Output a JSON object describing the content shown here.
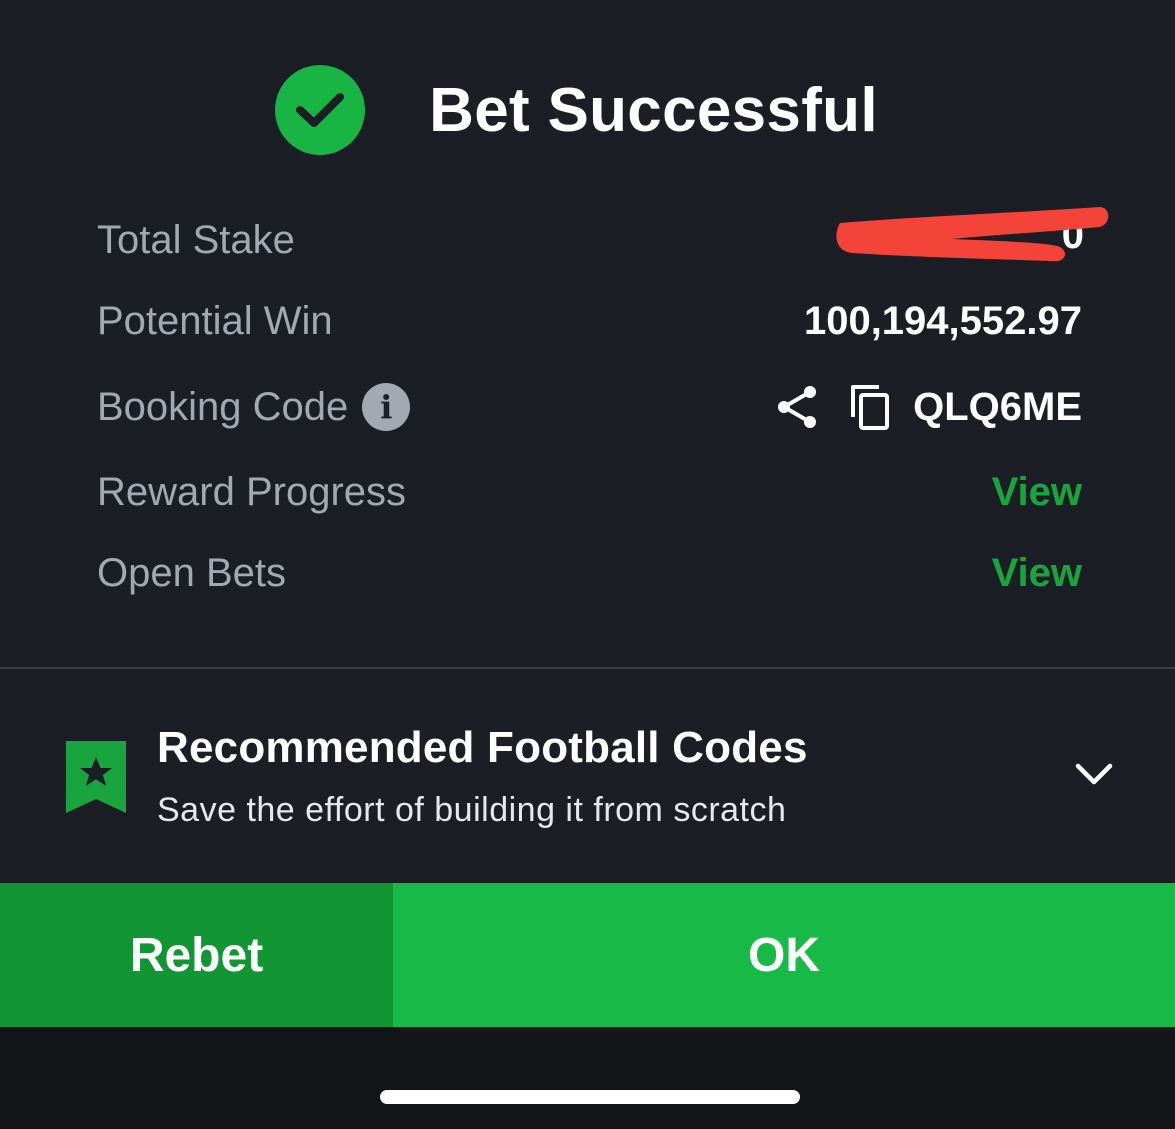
{
  "header": {
    "icon": "check-circle-icon",
    "title": "Bet Successful"
  },
  "details": {
    "total_stake": {
      "label": "Total Stake",
      "value_visible_fragment": "0",
      "redacted": true,
      "redaction_color": "#f4443a"
    },
    "potential_win": {
      "label": "Potential Win",
      "value": "100,194,552.97"
    },
    "booking_code": {
      "label": "Booking Code",
      "info_icon": "info-icon",
      "info_glyph": "i",
      "share_icon": "share-icon",
      "copy_icon": "copy-icon",
      "value": "QLQ6ME"
    },
    "reward_progress": {
      "label": "Reward Progress",
      "link": "View"
    },
    "open_bets": {
      "label": "Open Bets",
      "link": "View"
    }
  },
  "recommended": {
    "icon": "bookmark-star-icon",
    "title": "Recommended Football Codes",
    "subtitle": "Save the effort of building it from scratch",
    "toggle_icon": "chevron-down-icon"
  },
  "actions": {
    "rebet_label": "Rebet",
    "ok_label": "OK"
  },
  "colors": {
    "background": "#1b1e25",
    "accent_green": "#18a53e",
    "rebet_green": "#129634",
    "ok_green": "#17ba47",
    "label_gray": "#a3a8b2"
  }
}
